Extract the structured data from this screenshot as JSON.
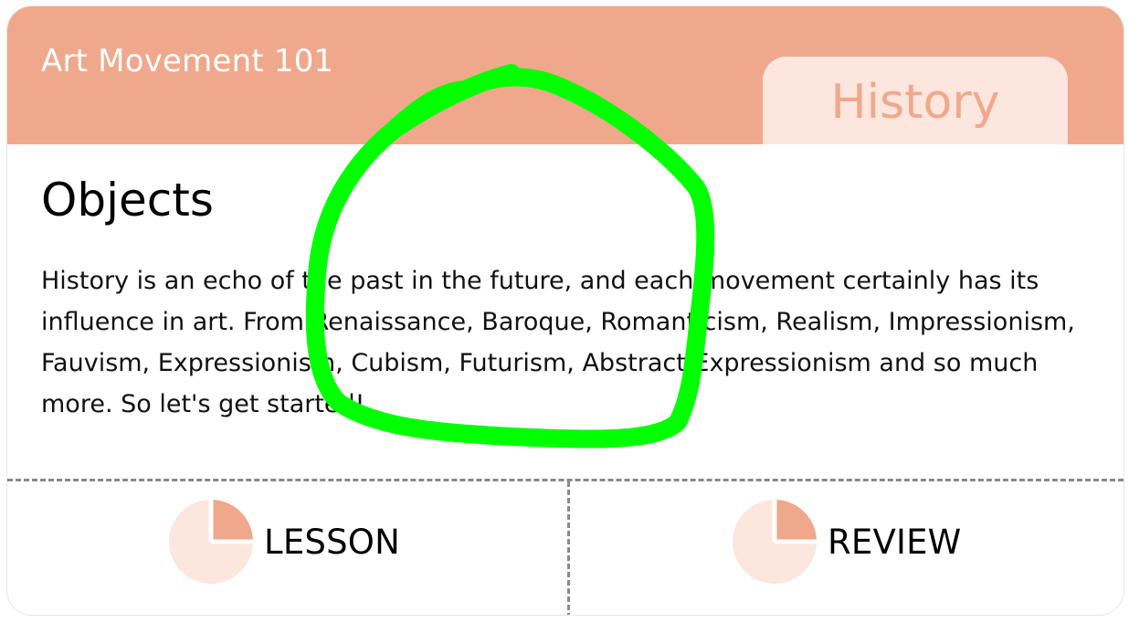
{
  "card": {
    "course_title": "Art Movement 101",
    "tab_label": "History",
    "heading": "Objects",
    "description": "History is an echo of the past in the future, and each movement certainly has its influence in art. From Renaissance, Baroque, Romanticism, Realism, Impressionism, Fauvism, Expressionism, Cubism, Futurism, Abstract Expressionism and so much more. So let's get started!"
  },
  "actions": [
    {
      "label": "LESSON",
      "icon": "pie-chart-icon"
    },
    {
      "label": "REVIEW",
      "icon": "pie-chart-icon"
    }
  ],
  "colors": {
    "header": "#f0a88c",
    "tab_background": "#fde6de",
    "pie_slice": "#f0a88c",
    "pie_background": "#fde6de",
    "annotation": "#00ff00"
  }
}
